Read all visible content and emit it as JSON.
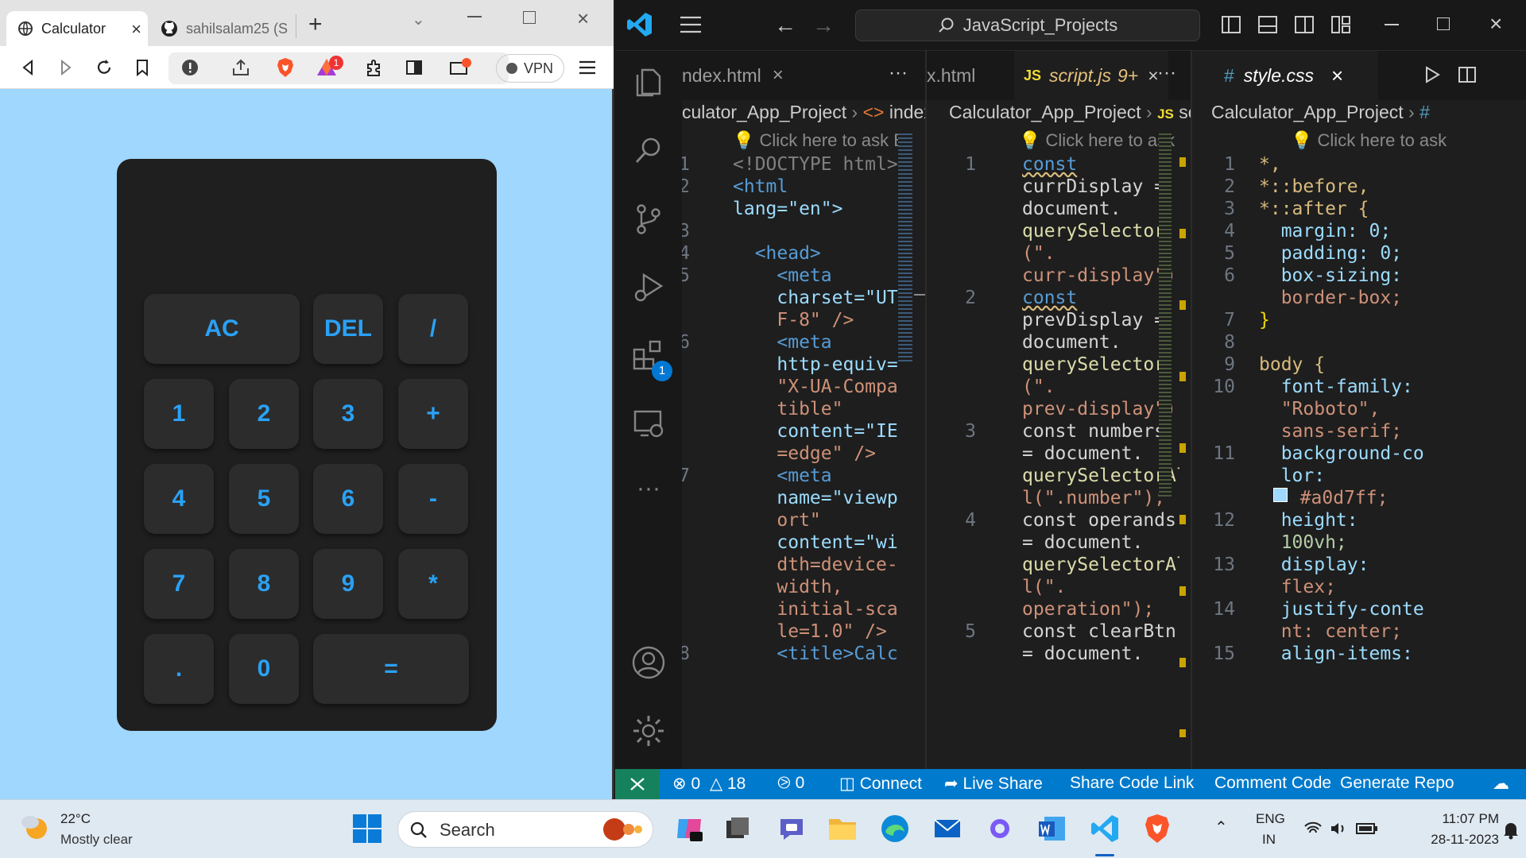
{
  "browser": {
    "tabs": [
      {
        "label": "Calculator"
      },
      {
        "label": "sahilsalam25 (S"
      }
    ],
    "new_tab": "+",
    "vpn_label": "VPN",
    "brave_badge": "1"
  },
  "calculator": {
    "keys": [
      {
        "id": "ac",
        "label": "AC"
      },
      {
        "id": "del",
        "label": "DEL"
      },
      {
        "id": "divide",
        "label": "/"
      },
      {
        "id": "1",
        "label": "1"
      },
      {
        "id": "2",
        "label": "2"
      },
      {
        "id": "3",
        "label": "3"
      },
      {
        "id": "plus",
        "label": "+"
      },
      {
        "id": "4",
        "label": "4"
      },
      {
        "id": "5",
        "label": "5"
      },
      {
        "id": "6",
        "label": "6"
      },
      {
        "id": "minus",
        "label": "-"
      },
      {
        "id": "7",
        "label": "7"
      },
      {
        "id": "8",
        "label": "8"
      },
      {
        "id": "9",
        "label": "9"
      },
      {
        "id": "multiply",
        "label": "*"
      },
      {
        "id": "dot",
        "label": "."
      },
      {
        "id": "0",
        "label": "0"
      },
      {
        "id": "equals",
        "label": "="
      }
    ],
    "key_color": "#2aa1f5"
  },
  "vscode": {
    "search_label": "JavaScript_Projects",
    "extensions_badge": "1",
    "panes": [
      {
        "tab": "ndex.html",
        "tab2": "x.html",
        "crumb_folder": "culator_App_Project",
        "crumb_file": "index.",
        "hint": "Click here to ask Bla",
        "line_numbers": [
          "1",
          "2",
          "3",
          "4",
          "5",
          "6",
          "7",
          "8"
        ],
        "lines": [
          "<!DOCTYPE html>",
          "<html",
          "lang=\"en\">",
          "",
          "  <head>",
          "    <meta",
          "    charset=\"UT",
          "    F-8\" />",
          "    <meta",
          "    http-equiv=",
          "    \"X-UA-Compa",
          "    tible\"",
          "    content=\"IE",
          "    =edge\" />",
          "    <meta",
          "    name=\"viewp",
          "    ort\"",
          "    content=\"wi",
          "    dth=device-",
          "    width,",
          "    initial-sca",
          "    le=1.0\" />",
          "    <title>Calc"
        ]
      },
      {
        "tab": "script.js",
        "tab_badge": "9+",
        "crumb_folder": "Calculator_App_Project",
        "crumb_file": "script.",
        "hint": "Click here to ask Bla",
        "line_numbers": [
          "1",
          "2",
          "3",
          "4",
          "5"
        ],
        "lines": [
          "const",
          "currDisplay =",
          "document.",
          "querySelector",
          "(\".",
          "curr-display\");",
          "const",
          "prevDisplay =",
          "document.",
          "querySelector",
          "(\".",
          "prev-display\");",
          "const numbers",
          "= document.",
          "querySelectorAl",
          "l(\".number\");",
          "const operands",
          "= document.",
          "querySelectorAl",
          "l(\".",
          "operation\");",
          "const clearBtn",
          "= document."
        ]
      },
      {
        "tab": "style.css",
        "crumb_folder": "Calculator_App_Project",
        "crumb_file": "#",
        "hint": "Click here to ask B",
        "line_numbers": [
          "1",
          "2",
          "3",
          "4",
          "5",
          "6",
          "7",
          "8",
          "9",
          "10",
          "11",
          "12",
          "13",
          "14",
          "15"
        ],
        "lines": [
          "*,",
          "*::before,",
          "*::after {",
          "  margin: 0;",
          "  padding: 0;",
          "  box-sizing:",
          "  border-box;",
          "}",
          "",
          "body {",
          "  font-family:",
          "  \"Roboto\",",
          "  sans-serif;",
          "  background-co",
          "  lor:",
          "  #a0d7ff;",
          "  height:",
          "  100vh;",
          "  display:",
          "  flex;",
          "  justify-conte",
          "  nt: center;",
          "  align-items:"
        ],
        "swatch_color": "#a0d7ff"
      }
    ],
    "statusbar": {
      "errors": "0",
      "warnings": "18",
      "ports": "0",
      "connect": "Connect",
      "live_share": "Live Share",
      "share_code_link": "Share Code Link",
      "comment_code": "Comment Code",
      "generate_repo": "Generate Repo"
    }
  },
  "taskbar": {
    "weather_temp": "22°C",
    "weather_desc": "Mostly clear",
    "search_placeholder": "Search",
    "lang_top": "ENG",
    "lang_bottom": "IN",
    "time": "11:07 PM",
    "date": "28-11-2023"
  }
}
